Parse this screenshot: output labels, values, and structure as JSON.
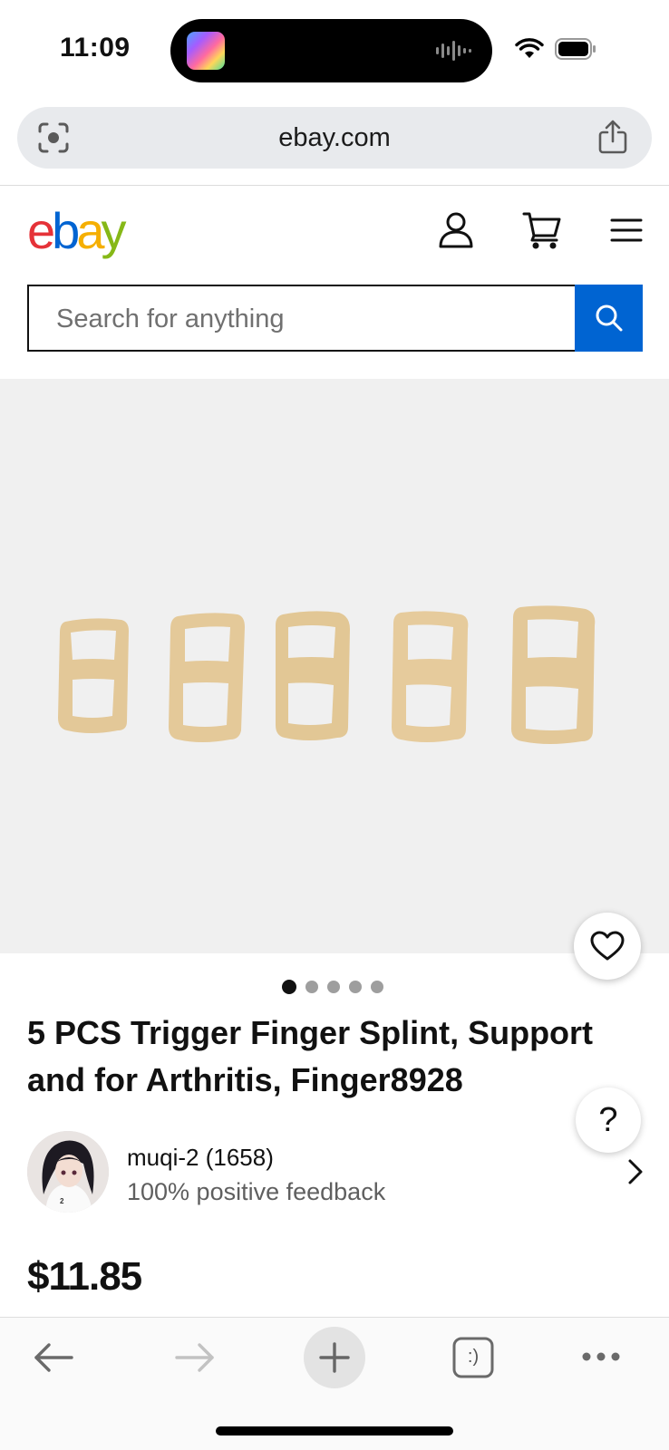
{
  "status_bar": {
    "time": "11:09"
  },
  "browser": {
    "url": "ebay.com"
  },
  "header": {
    "logo_letters": [
      {
        "char": "e",
        "color": "#e53238"
      },
      {
        "char": "b",
        "color": "#0064d2"
      },
      {
        "char": "a",
        "color": "#f5af02"
      },
      {
        "char": "y",
        "color": "#86b817"
      }
    ],
    "icons": [
      "account-icon",
      "cart-icon",
      "menu-icon"
    ]
  },
  "search": {
    "placeholder": "Search for anything",
    "button_color": "#0064d2"
  },
  "product": {
    "image_count": 5,
    "active_image": 1,
    "title": "5 PCS Trigger Finger Splint, Support and for Arthritis, Finger8928",
    "price": "$11.85"
  },
  "seller": {
    "name": "muqi-2 (1658)",
    "feedback": "100% positive feedback"
  },
  "help": {
    "label": "?"
  },
  "toolbar": {
    "items": [
      "back-icon",
      "forward-icon",
      "new-tab-icon",
      "tabs-icon",
      "more-icon"
    ],
    "tabs_label": ":)"
  }
}
